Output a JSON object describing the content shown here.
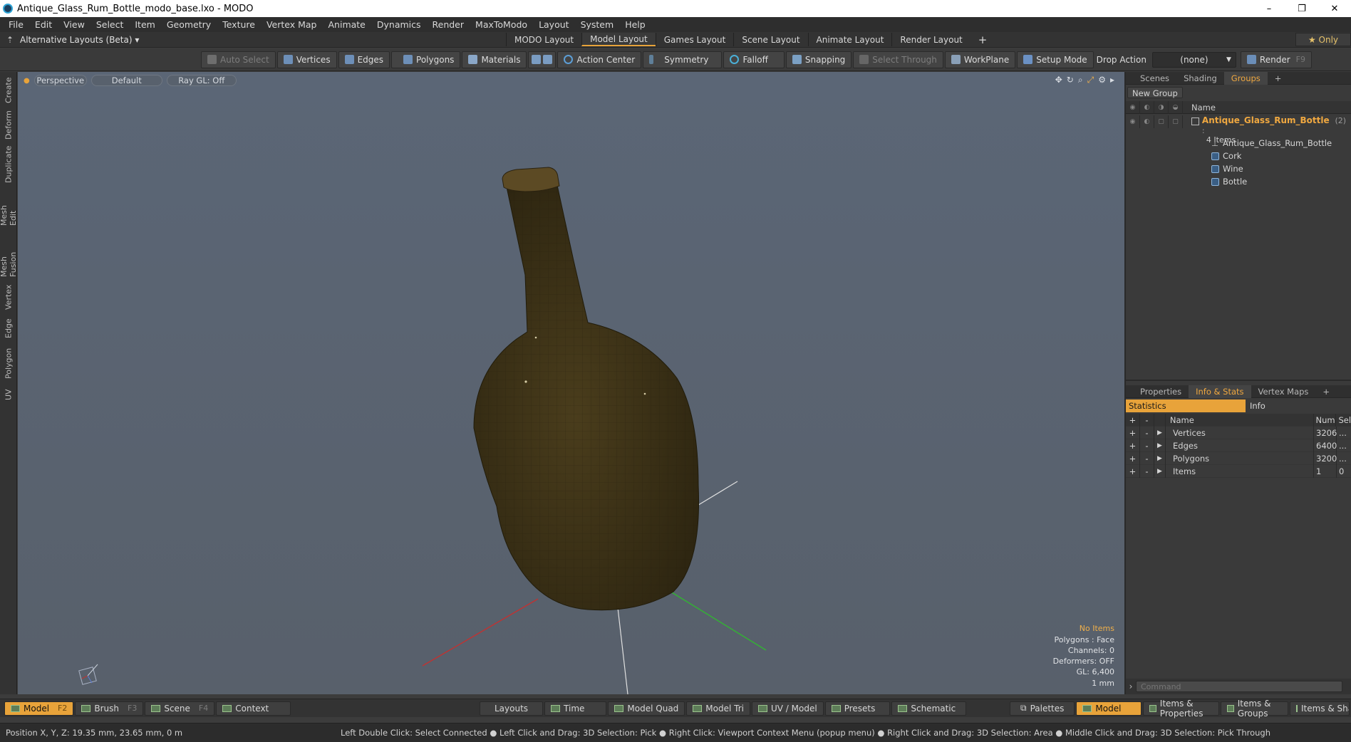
{
  "window": {
    "title": "Antique_Glass_Rum_Bottle_modo_base.lxo - MODO",
    "minimize": "–",
    "restore": "❐",
    "close": "✕"
  },
  "menu": [
    "File",
    "Edit",
    "View",
    "Select",
    "Item",
    "Geometry",
    "Texture",
    "Vertex Map",
    "Animate",
    "Dynamics",
    "Render",
    "MaxToModo",
    "Layout",
    "System",
    "Help"
  ],
  "layouts": {
    "switcher": "Alternative Layouts (Beta) ▾",
    "tabs": [
      "MODO Layout",
      "Model Layout",
      "Games Layout",
      "Scene Layout",
      "Animate Layout",
      "Render Layout"
    ],
    "active": "Model Layout",
    "add": "+",
    "only": "★  Only"
  },
  "toolbar": {
    "auto_select": "Auto Select",
    "vertices": "Vertices",
    "edges": "Edges",
    "polygons": "Polygons",
    "materials": "Materials",
    "action_center": "Action Center",
    "symmetry": "Symmetry",
    "falloff": "Falloff",
    "snapping": "Snapping",
    "select_through": "Select Through",
    "workplane": "WorkPlane",
    "setup_mode": "Setup Mode",
    "drop_action_label": "Drop Action",
    "drop_action_value": "(none)",
    "render": "Render",
    "render_key": "F9"
  },
  "left_tabs": [
    "Create",
    "Deform",
    "Duplicate",
    "Mesh Edit",
    "Mesh Fusion",
    "Vertex",
    "Edge",
    "Polygon",
    "UV"
  ],
  "viewport": {
    "view": "Perspective",
    "shading": "Default",
    "raygl": "Ray GL: Off",
    "info": {
      "selection": "No Items",
      "polygons": "Polygons : Face",
      "channels": "Channels: 0",
      "deformers": "Deformers: OFF",
      "gl": "GL: 6,400",
      "unit": "1 mm"
    }
  },
  "groups_panel": {
    "tabs": [
      "Scenes",
      "Shading",
      "Groups"
    ],
    "active": "Groups",
    "new_group": "New Group",
    "name_header": "Name",
    "group_name": "Antique_Glass_Rum_Bottle",
    "group_count": "(2) :",
    "group_items": "4 Items",
    "children": [
      "Antique_Glass_Rum_Bottle",
      "Cork",
      "Wine",
      "Bottle"
    ]
  },
  "info_panel": {
    "tabs": [
      "Properties",
      "Info & Stats",
      "Vertex Maps"
    ],
    "active": "Info & Stats",
    "subtabs": [
      "Statistics",
      "Info"
    ],
    "headers": {
      "name": "Name",
      "num": "Num",
      "sel": "Sel"
    },
    "rows": [
      {
        "name": "Vertices",
        "num": "3206",
        "sel": "..."
      },
      {
        "name": "Edges",
        "num": "6400",
        "sel": "..."
      },
      {
        "name": "Polygons",
        "num": "3200",
        "sel": "..."
      },
      {
        "name": "Items",
        "num": "1",
        "sel": "0"
      }
    ],
    "command_placeholder": "Command"
  },
  "bottom": {
    "left": [
      {
        "label": "Model",
        "key": "F2"
      },
      {
        "label": "Brush",
        "key": "F3"
      },
      {
        "label": "Scene",
        "key": "F4"
      },
      {
        "label": "Context",
        "key": ""
      }
    ],
    "center": [
      "Layouts",
      "Time",
      "Model Quad",
      "Model Tri",
      "UV / Model",
      "Presets",
      "Schematic"
    ],
    "right": [
      "Palettes",
      "Model",
      "Items & Properties",
      "Items & Groups",
      "Items & Shading"
    ]
  },
  "status": {
    "position": "Position X, Y, Z:   19.35 mm, 23.65 mm, 0 m",
    "hints": "Left Double Click: Select Connected ● Left Click and Drag: 3D Selection: Pick ● Right Click: Viewport Context Menu (popup menu) ● Right Click and Drag: 3D Selection: Area ● Middle Click and Drag: 3D Selection: Pick Through"
  }
}
